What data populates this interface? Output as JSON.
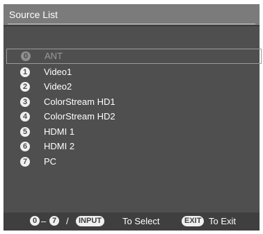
{
  "window": {
    "title": "Source List"
  },
  "sources": [
    {
      "number": "0",
      "label": "ANT",
      "selected": true
    },
    {
      "number": "1",
      "label": "Video1",
      "selected": false
    },
    {
      "number": "2",
      "label": "Video2",
      "selected": false
    },
    {
      "number": "3",
      "label": "ColorStream HD1",
      "selected": false
    },
    {
      "number": "4",
      "label": "ColorStream HD2",
      "selected": false
    },
    {
      "number": "5",
      "label": "HDMI 1",
      "selected": false
    },
    {
      "number": "6",
      "label": "HDMI 2",
      "selected": false
    },
    {
      "number": "7",
      "label": "PC",
      "selected": false
    }
  ],
  "footer": {
    "range_start": "0",
    "range_dash": "–",
    "range_end": "7",
    "slash": "/",
    "input_key": "INPUT",
    "select_text": "To Select",
    "exit_key": "EXIT",
    "exit_text": "To Exit"
  },
  "colors": {
    "panel": "#4f4f4f",
    "title_bar": "#7b7b7b",
    "footer": "#3f3f3f",
    "text": "#ffffff",
    "selected_text": "#9a9a9a"
  }
}
